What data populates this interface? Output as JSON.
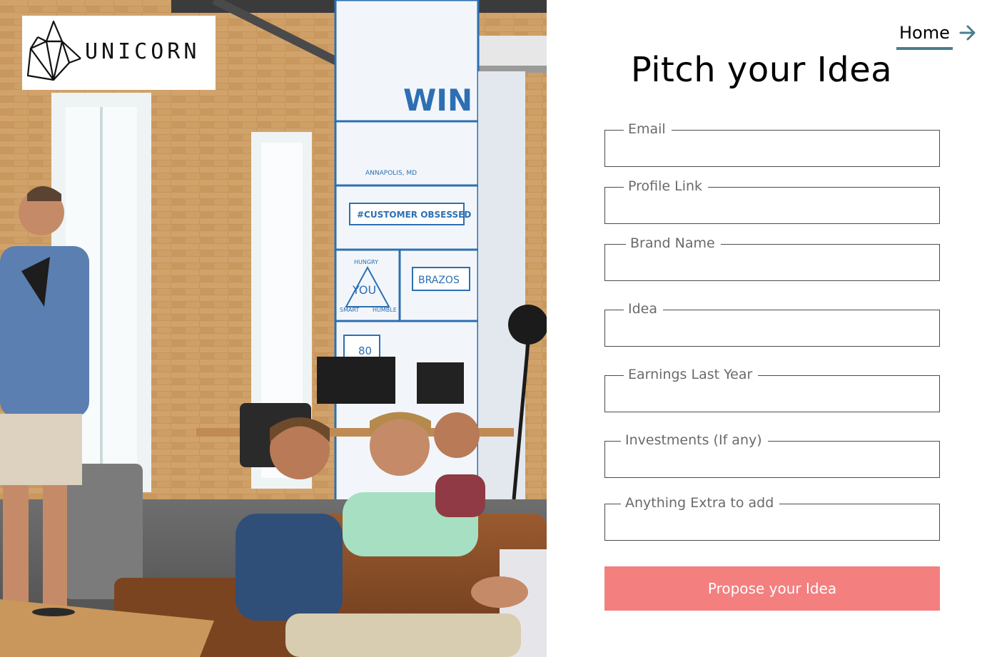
{
  "brand": {
    "logo_text": "UNICORN"
  },
  "nav": {
    "home_label": "Home",
    "home_icon": "arrow-right-icon"
  },
  "page": {
    "title": "Pitch your Idea"
  },
  "form": {
    "fields": [
      {
        "label": "Email",
        "value": ""
      },
      {
        "label": "Profile Link",
        "value": ""
      },
      {
        "label": "Brand Name",
        "value": ""
      },
      {
        "label": "Idea",
        "value": ""
      },
      {
        "label": "Earnings Last Year",
        "value": ""
      },
      {
        "label": "Investments (If any)",
        "value": ""
      },
      {
        "label": "Anything Extra to add",
        "value": ""
      }
    ],
    "submit_label": "Propose your Idea"
  },
  "photo": {
    "wall_signs": [
      "WIN",
      "ANNAPOLIS, MD",
      "#CUSTOMER OBSESSED",
      "HUNGRY",
      "YOU",
      "SMART",
      "HUMBLE",
      "BRAZOS",
      "80"
    ]
  },
  "colors": {
    "accent": "#4a7e8c",
    "button": "#f47f7f",
    "field_border": "#4c4c4c",
    "label": "#6a6a6a"
  }
}
